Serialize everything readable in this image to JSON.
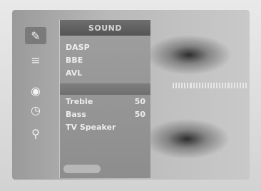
{
  "menu": {
    "title": "SOUND",
    "top_items": [
      {
        "label": "DASP"
      },
      {
        "label": "BBE"
      },
      {
        "label": "AVL"
      }
    ],
    "settings": [
      {
        "label": "Treble",
        "value": "50"
      },
      {
        "label": "Bass",
        "value": "50"
      },
      {
        "label": "TV Speaker",
        "value": ""
      }
    ]
  },
  "icons": [
    {
      "name": "picture-icon",
      "glyph": "✎",
      "active": true
    },
    {
      "name": "menu-lines-icon",
      "glyph": "≡",
      "active": false
    },
    {
      "name": "speaker-icon",
      "glyph": "◉",
      "active": false
    },
    {
      "name": "clock-icon",
      "glyph": "◷",
      "active": false
    },
    {
      "name": "key-icon",
      "glyph": "⚲",
      "active": false
    }
  ]
}
